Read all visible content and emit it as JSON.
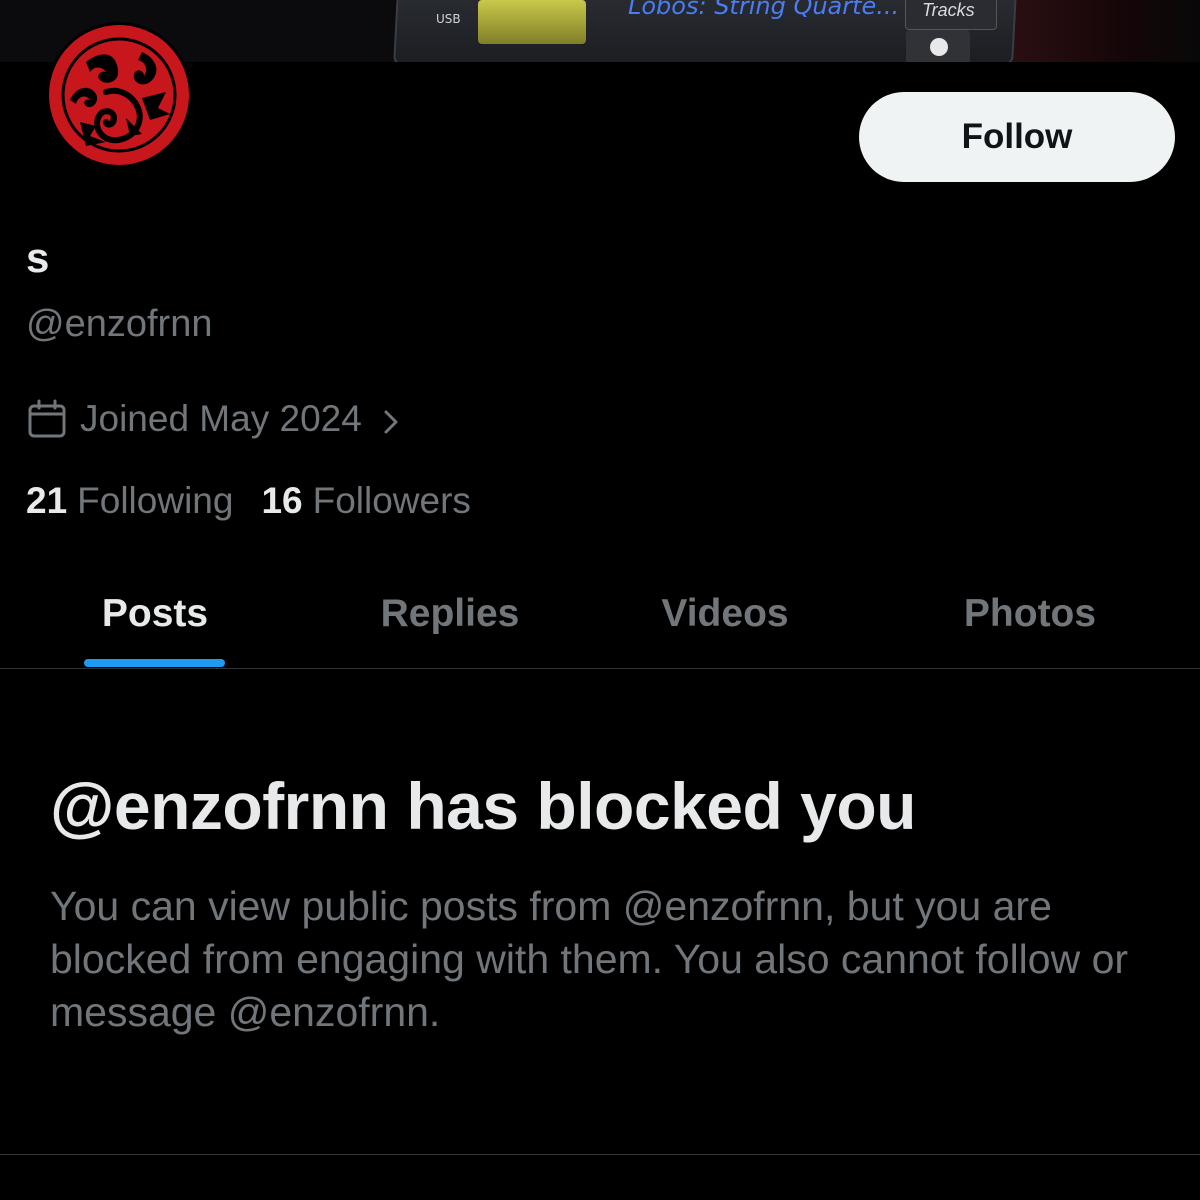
{
  "banner": {
    "usb_label": "USB",
    "now_playing": "Lobos: String Quarte...",
    "tracks_label": "Tracks"
  },
  "profile": {
    "display_name": "s",
    "handle": "@enzofrnn",
    "joined": "Joined May 2024",
    "following_count": "21",
    "following_label": "Following",
    "followers_count": "16",
    "followers_label": "Followers"
  },
  "actions": {
    "follow_label": "Follow"
  },
  "tabs": [
    {
      "label": "Posts",
      "active": true
    },
    {
      "label": "Replies",
      "active": false
    },
    {
      "label": "Videos",
      "active": false
    },
    {
      "label": "Photos",
      "active": false
    }
  ],
  "blocked": {
    "title": "@enzofrnn has blocked you",
    "description": "You can view public posts from @enzofrnn, but you are blocked from engaging with them. You also cannot follow or message @enzofrnn."
  },
  "colors": {
    "background": "#000000",
    "primary_text": "#e7e9ea",
    "secondary_text": "#71767b",
    "accent": "#1d9bf0",
    "follow_button_bg": "#eff3f4",
    "avatar_red": "#c8161d"
  },
  "icons": {
    "joined": "calendar-icon",
    "joined_more": "chevron-right-icon",
    "avatar": "three-headed-dragon-sigil"
  }
}
